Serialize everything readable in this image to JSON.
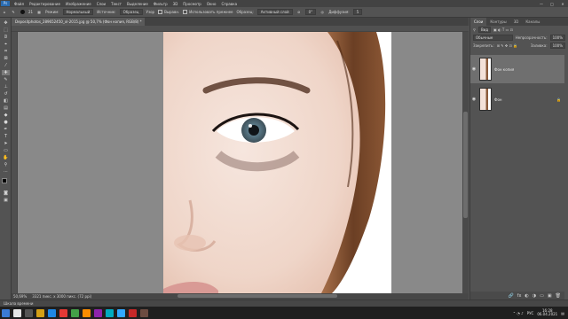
{
  "menubar": {
    "logo": "Ps",
    "items": [
      "Файл",
      "Редактирование",
      "Изображение",
      "Слои",
      "Текст",
      "Выделение",
      "Фильтр",
      "3D",
      "Просмотр",
      "Окно",
      "Справка"
    ],
    "win_minimize": "—",
    "win_maximize": "□",
    "win_close": "✕"
  },
  "options": {
    "brush_size": "21",
    "source_label": "Режим:",
    "mode_value": "Нормальный",
    "sample_label": "Источник:",
    "sampled_btn": "Образец",
    "pattern_btn": "Узор",
    "aligned_label": "Выравн.",
    "use_legacy_label": "Использовать прежнее",
    "sample_all_label": "Образец:",
    "sample_value": "Активный слой",
    "angle_value": "0°",
    "diffusion_label": "Диффузия:",
    "diffusion_value": "5"
  },
  "document": {
    "tab_title": "Depositphotos_289652450_xl-2015.jpg @ 50,7% (Фон копия, RGB/8) *",
    "tab_close": "×"
  },
  "status": {
    "zoom": "50,69%",
    "doc_size": "3321 пикс. х 3000 пикс. (72 ppi)"
  },
  "timeline_label": "Шкала времени",
  "panel": {
    "tabs": [
      "Слои",
      "Контуры",
      "3D",
      "Каналы"
    ],
    "active_tab": "Слои",
    "filter_label": "Вид",
    "blend_mode": "Обычные",
    "opacity_label": "Непрозрачность:",
    "opacity_value": "100%",
    "lock_label": "Закрепить:",
    "fill_label": "Заливка:",
    "fill_value": "100%",
    "layers": [
      {
        "name": "Фон копия",
        "selected": true
      },
      {
        "name": "Фон",
        "selected": false
      }
    ],
    "footer_icons": [
      "🔗",
      "fx",
      "◐",
      "◑",
      "▭",
      "▣",
      "🗑"
    ]
  },
  "taskbar": {
    "lang": "РУС",
    "time": "16:28",
    "date": "06.04.2021"
  },
  "colors": {
    "accent": "#2b6cb0",
    "foreground_swatch": "#000000",
    "background_swatch": "#ffffff"
  }
}
